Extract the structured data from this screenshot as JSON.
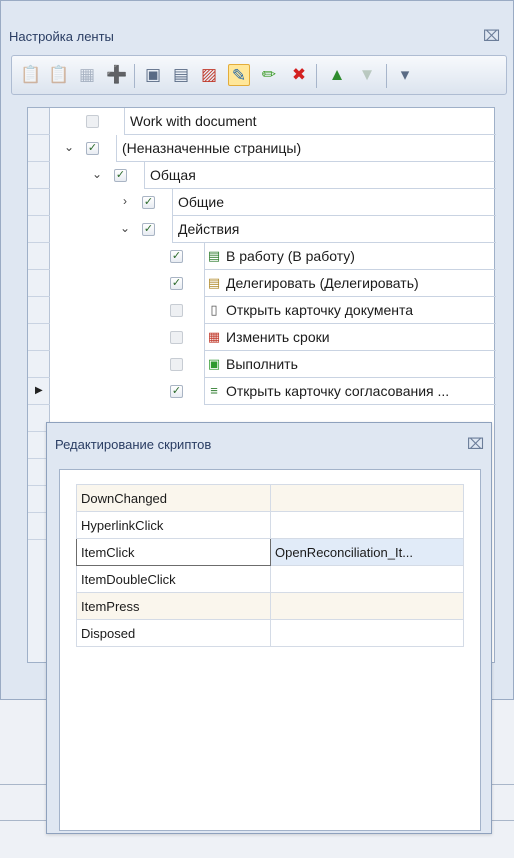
{
  "panel": {
    "title": "Настройка ленты",
    "close_glyph": "⌧"
  },
  "toolbar": {
    "buttons": [
      {
        "icon": "paste-icon",
        "glyph": "📋",
        "enabled": false
      },
      {
        "icon": "paste-page-icon",
        "glyph": "📋",
        "enabled": false
      },
      {
        "icon": "grid-icon",
        "glyph": "▦",
        "enabled": false
      },
      {
        "icon": "add-page-icon",
        "glyph": "➕",
        "enabled": true
      },
      {
        "icon": "add-group-icon",
        "glyph": "▣",
        "enabled": true
      },
      {
        "icon": "add-item-icon",
        "glyph": "▤",
        "enabled": true
      },
      {
        "icon": "add-special-icon",
        "glyph": "▨",
        "enabled": true
      },
      {
        "icon": "script-icon",
        "glyph": "✎",
        "enabled": true,
        "active": true
      },
      {
        "icon": "edit-pencil-icon",
        "glyph": "✏",
        "enabled": true
      },
      {
        "icon": "delete-icon",
        "glyph": "✖",
        "enabled": true
      },
      {
        "icon": "move-up-icon",
        "glyph": "▲",
        "enabled": true
      },
      {
        "icon": "move-down-icon",
        "glyph": "▼",
        "enabled": false
      },
      {
        "icon": "dropdown-icon",
        "glyph": "▾",
        "enabled": true
      }
    ]
  },
  "tree": {
    "row_pointer_glyph": "▶",
    "rows": [
      {
        "label": "Work with document",
        "checked": false,
        "expand": "",
        "icon": ""
      },
      {
        "label": "(Неназначенные страницы)",
        "checked": true,
        "expand": "⌄",
        "icon": ""
      },
      {
        "label": "Общая",
        "checked": true,
        "expand": "⌄",
        "icon": ""
      },
      {
        "label": "Общие",
        "checked": true,
        "expand": "›",
        "icon": ""
      },
      {
        "label": "Действия",
        "checked": true,
        "expand": "⌄",
        "icon": ""
      },
      {
        "label": "В работу (В работу)",
        "checked": true,
        "expand": "",
        "icon": "document-go-icon"
      },
      {
        "label": "Делегировать (Делегировать)",
        "checked": true,
        "expand": "",
        "icon": "document-delegate-icon"
      },
      {
        "label": "Открыть карточку документа",
        "checked": false,
        "expand": "",
        "icon": "document-icon"
      },
      {
        "label": "Изменить сроки",
        "checked": false,
        "expand": "",
        "icon": "calendar-icon"
      },
      {
        "label": "Выполнить",
        "checked": false,
        "expand": "",
        "icon": "execute-icon"
      },
      {
        "label": "Открыть карточку согласования ...",
        "checked": true,
        "expand": "",
        "icon": "approval-card-icon"
      }
    ]
  },
  "dialog": {
    "title": "Редактирование скриптов",
    "close_glyph": "⌧",
    "properties": [
      {
        "name": "DownChanged",
        "value": ""
      },
      {
        "name": "HyperlinkClick",
        "value": ""
      },
      {
        "name": "ItemClick",
        "value": "OpenReconciliation_It..."
      },
      {
        "name": "ItemDoubleClick",
        "value": ""
      },
      {
        "name": "ItemPress",
        "value": ""
      },
      {
        "name": "Disposed",
        "value": ""
      }
    ],
    "selected_index": 2
  },
  "colors": {
    "panel_bg": "#dfe7f2",
    "accent_check": "#2b6a2b",
    "active_button": "#ffe79a"
  }
}
